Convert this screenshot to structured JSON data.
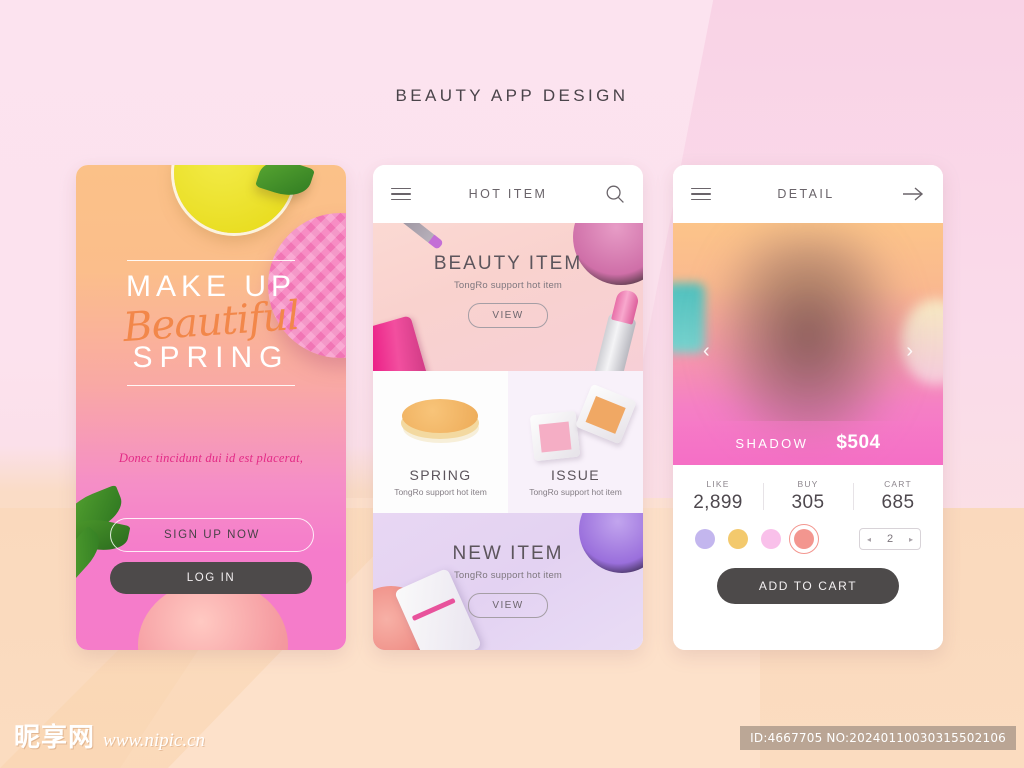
{
  "page": {
    "title": "BEAUTY APP DESIGN",
    "background_pink": "#fce3ef",
    "background_peach": "#fbdcc0"
  },
  "screen1": {
    "headline_top": "MAKE UP",
    "headline_script": "Beautiful",
    "headline_bottom": "SPRING",
    "tagline": "Donec tincidunt dui id est placerat,",
    "signup_label": "SIGN UP NOW",
    "login_label": "LOG IN",
    "accent_script_color": "#f2874a",
    "tagline_color": "#e32a86",
    "login_bg": "#4d4a4a"
  },
  "screen2": {
    "header": {
      "title": "HOT ITEM",
      "menu_icon": "hamburger-icon",
      "search_icon": "search-icon"
    },
    "sections": [
      {
        "title": "BEAUTY ITEM",
        "subtitle": "TongRo support hot item",
        "button": "VIEW"
      },
      {
        "title": "SPRING",
        "subtitle": "TongRo support hot item"
      },
      {
        "title": "ISSUE",
        "subtitle": "TongRo support hot item"
      },
      {
        "title": "NEW ITEM",
        "subtitle": "TongRo support hot item",
        "button": "VIEW"
      }
    ]
  },
  "screen3": {
    "header": {
      "title": "DETAIL",
      "menu_icon": "hamburger-icon",
      "next_icon": "arrow-right-icon"
    },
    "carousel": {
      "prev": "‹",
      "next": "›"
    },
    "product_name": "SHADOW",
    "product_price": "$504",
    "stats": [
      {
        "label": "LIKE",
        "value": "2,899"
      },
      {
        "label": "BUY",
        "value": "305"
      },
      {
        "label": "CART",
        "value": "685"
      }
    ],
    "swatches": [
      {
        "name": "lavender",
        "color": "#c3b6ee"
      },
      {
        "name": "gold",
        "color": "#f3c96d"
      },
      {
        "name": "pink",
        "color": "#f9c0ea"
      },
      {
        "name": "coral",
        "color": "#f3968f",
        "selected": true
      }
    ],
    "quantity": "2",
    "stepper_prev": "◂",
    "stepper_next": "▸",
    "add_to_cart": "ADD TO CART"
  },
  "watermark": {
    "logo_cn": "昵享网",
    "url": "www.nipic.cn",
    "id_text": "ID:4667705 NO:20240110030315502106"
  }
}
